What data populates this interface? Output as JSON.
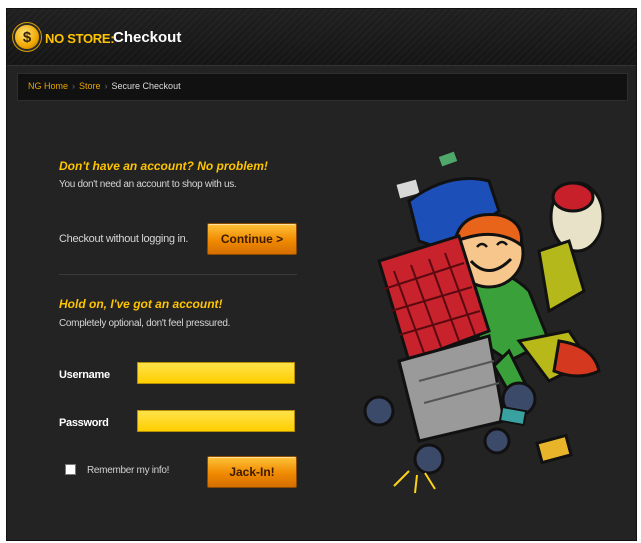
{
  "header": {
    "logo_glyph": "$",
    "brand": "NO STORE:",
    "title": "Checkout"
  },
  "breadcrumb": {
    "items": [
      "NG Home",
      "Store",
      "Secure Checkout"
    ],
    "separator": "›"
  },
  "guest": {
    "heading": "Don't have an account? No problem!",
    "subtext": "You don't need an account to shop with us.",
    "prompt": "Checkout without logging in.",
    "button": "Continue >"
  },
  "login": {
    "heading": "Hold on, I've got an account!",
    "subtext": "Completely optional, don't feel pressured.",
    "username_label": "Username",
    "username_value": "",
    "password_label": "Password",
    "password_value": "",
    "remember_label": "Remember my info!",
    "button": "Jack-In!"
  },
  "colors": {
    "accent": "#ffc400",
    "button": "#f08a00",
    "background": "#232323",
    "field": "#ffd21a"
  },
  "illustration": "mascot-shopping-cart"
}
